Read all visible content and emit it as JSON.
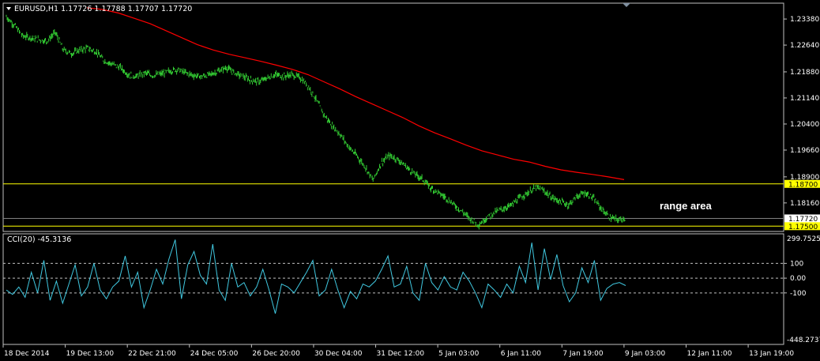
{
  "chart_data": {
    "type": "line",
    "symbol": "EURUSD,H1",
    "ohlc_readout": "1.17726 1.17788 1.17707 1.17720",
    "x_ticks": [
      "18 Dec 2014",
      "19 Dec 13:00",
      "22 Dec 21:00",
      "24 Dec 05:00",
      "26 Dec 20:00",
      "30 Dec 04:00",
      "31 Dec 12:00",
      "5 Jan 03:00",
      "6 Jan 11:00",
      "7 Jan 19:00",
      "9 Jan 03:00",
      "12 Jan 11:00",
      "13 Jan 19:00"
    ],
    "price_axis": {
      "ticks": [
        "1.23380",
        "1.22640",
        "1.21880",
        "1.21140",
        "1.20400",
        "1.19660",
        "1.18900",
        "1.18160"
      ],
      "ylim": [
        1.1735,
        1.2383
      ]
    },
    "price_series_color": "#33cc33",
    "ma_color": "#ff0000",
    "price_close": [
      1.2345,
      1.232,
      1.229,
      1.2285,
      1.228,
      1.2275,
      1.23,
      1.225,
      1.224,
      1.225,
      1.2255,
      1.2245,
      1.222,
      1.221,
      1.22,
      1.218,
      1.2175,
      1.2185,
      1.2178,
      1.2182,
      1.219,
      1.2195,
      1.2185,
      1.2178,
      1.2175,
      1.218,
      1.219,
      1.22,
      1.2185,
      1.2175,
      1.2165,
      1.216,
      1.217,
      1.218,
      1.2175,
      1.218,
      1.2172,
      1.215,
      1.211,
      1.2065,
      1.2035,
      1.201,
      1.1975,
      1.195,
      1.192,
      1.188,
      1.193,
      1.195,
      1.194,
      1.192,
      1.19,
      1.1885,
      1.186,
      1.1845,
      1.183,
      1.181,
      1.179,
      1.177,
      1.1755,
      1.1775,
      1.179,
      1.18,
      1.181,
      1.183,
      1.1845,
      1.186,
      1.185,
      1.183,
      1.182,
      1.181,
      1.1835,
      1.1845,
      1.183,
      1.18,
      1.1775,
      1.1768,
      1.1772
    ],
    "moving_average": [
      1.237,
      1.2365,
      1.2355,
      1.234,
      1.2325,
      1.2305,
      1.2285,
      1.2265,
      1.225,
      1.2238,
      1.2228,
      1.2218,
      1.2207,
      1.2195,
      1.218,
      1.216,
      1.214,
      1.2118,
      1.2098,
      1.2078,
      1.2058,
      1.2035,
      1.2015,
      1.1998,
      1.198,
      1.1964,
      1.1952,
      1.194,
      1.1932,
      1.192,
      1.191,
      1.1903,
      1.1897,
      1.189,
      1.1882
    ],
    "levels": [
      {
        "value": 1.187,
        "label": "1.18700",
        "color": "#ffff00",
        "style": "solid"
      },
      {
        "value": 1.1772,
        "label": "1.17720",
        "color": "#808080",
        "style": "solid"
      },
      {
        "value": 1.175,
        "label": "1.17500",
        "color": "#ffff00",
        "style": "solid"
      }
    ],
    "annotation": "range area",
    "cci": {
      "title": "CCI(20) -45.3136",
      "color": "#40c8e0",
      "max_label": "299.7525",
      "min_label": "-448.2737",
      "ylim": [
        -448.2737,
        299.7525
      ],
      "levels": [
        {
          "value": 100,
          "label": "100"
        },
        {
          "value": 0,
          "label": "0.00"
        },
        {
          "value": -100,
          "label": "-100"
        }
      ],
      "values": [
        -80,
        -110,
        -60,
        -130,
        40,
        -100,
        120,
        -150,
        -20,
        -170,
        -40,
        90,
        -120,
        -60,
        100,
        -80,
        -140,
        -60,
        -20,
        150,
        -60,
        40,
        -200,
        -80,
        60,
        -40,
        130,
        260,
        -140,
        90,
        180,
        20,
        -40,
        230,
        -80,
        -150,
        100,
        -60,
        -30,
        -120,
        -60,
        60,
        -80,
        -240,
        -40,
        -60,
        -100,
        -30,
        40,
        120,
        -120,
        -80,
        60,
        -80,
        -200,
        -90,
        -140,
        -40,
        -60,
        -20,
        60,
        150,
        -60,
        -40,
        80,
        -100,
        -150,
        100,
        -30,
        -80,
        10,
        -60,
        -80,
        40,
        -20,
        -100,
        -200,
        -40,
        -80,
        -130,
        -40,
        -100,
        80,
        -30,
        240,
        -80,
        200,
        -10,
        160,
        -50,
        -160,
        -100,
        70,
        -30,
        120,
        -150,
        -70,
        -40,
        -30,
        -50
      ]
    }
  }
}
